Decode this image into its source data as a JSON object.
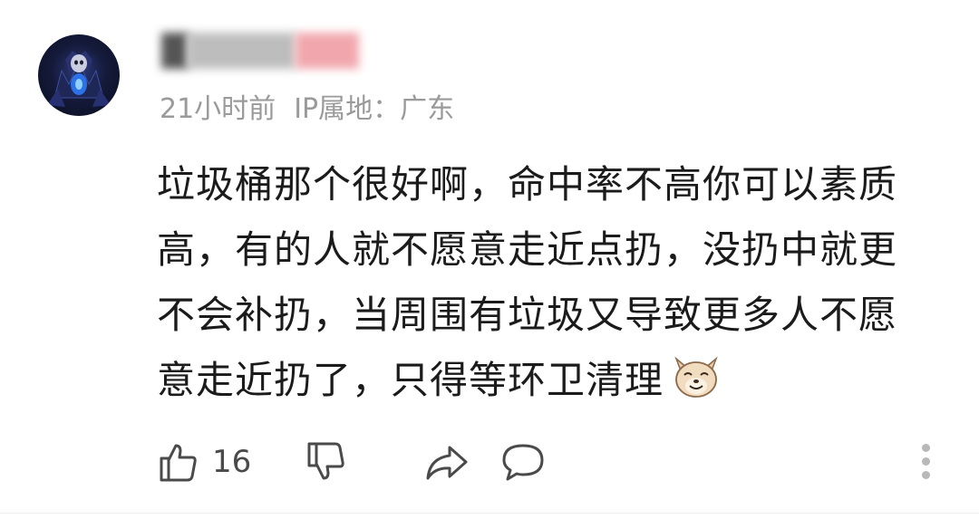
{
  "comment": {
    "avatar_icon": "avatar-image",
    "username_obscured": true,
    "time_ago": "21小时前",
    "ip_label": "IP属地：广东",
    "body_lines": [
      "垃圾桶那个很好啊，命中率不高你可以素质",
      "高，有的人就不愿意走近点扔，没扔中就更",
      "不会补扔，当周围有垃圾又导致更多人不愿",
      "意走近扔了，只得等环卫清理"
    ],
    "emoji_icon": "grinning-dog-emoji",
    "actions": {
      "like_icon": "thumbs-up-icon",
      "like_count": "16",
      "dislike_icon": "thumbs-down-icon",
      "share_icon": "share-icon",
      "reply_icon": "comment-bubble-icon",
      "more_icon": "more-vertical-icon"
    }
  },
  "colors": {
    "text": "#1b1b1b",
    "meta": "#9a9a9a",
    "icon": "#4a4a4a",
    "more_dots": "#b8b8b8"
  }
}
